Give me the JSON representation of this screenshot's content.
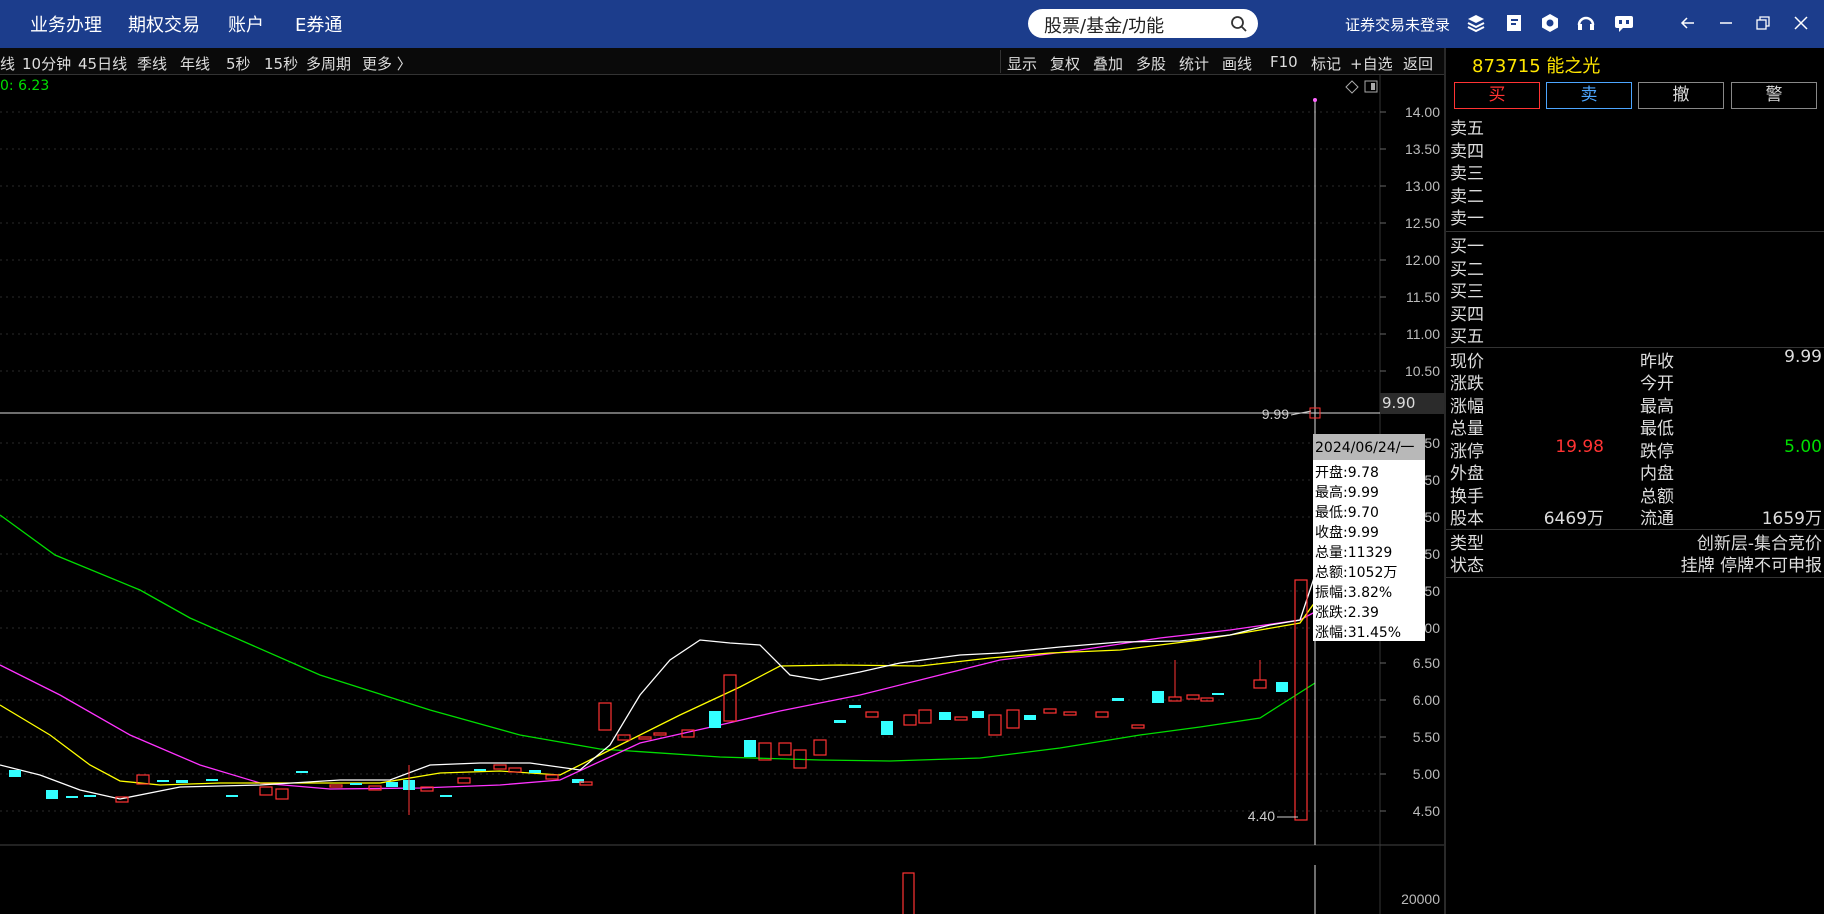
{
  "topbar": {
    "menu": [
      "业务办理",
      "期权交易",
      "账户",
      "E券通"
    ],
    "search_placeholder": "股票/基金/功能",
    "login_status": "证券交易未登录"
  },
  "toolbar": {
    "periods": [
      "线",
      "10分钟",
      "45日线",
      "季线",
      "年线",
      "5秒",
      "15秒",
      "多周期",
      "更多 〉"
    ],
    "tools": [
      "显示",
      "复权",
      "叠加",
      "多股",
      "统计",
      "画线",
      "F10",
      "标记",
      "+自选",
      "返回"
    ]
  },
  "chart": {
    "ma_readout": "0: 6.23",
    "y_ticks": [
      "14.00",
      "13.50",
      "13.00",
      "12.50",
      "12.00",
      "11.50",
      "11.00",
      "10.50",
      "6.50",
      "6.00",
      "5.50",
      "5.00",
      "4.50"
    ],
    "hidden_ticks": [
      "50",
      "50",
      "50",
      "50",
      "50",
      "00"
    ],
    "crosshair_price": "9.90",
    "high_marker": "9.99",
    "low_marker": "4.40",
    "volume_tick": "20000",
    "colors": {
      "up": "#ff3333",
      "down": "#33ffff",
      "ma1": "#ffffff",
      "ma2": "#ffff00",
      "ma3": "#ff33ff",
      "ma4": "#00dd00"
    }
  },
  "tooltip": {
    "date": "2024/06/24/一",
    "open": "开盘:9.78",
    "high": "最高:9.99",
    "low": "最低:9.70",
    "close": "收盘:9.99",
    "volume": "总量:11329",
    "amount": "总额:1052万",
    "amplitude": "振幅:3.82%",
    "change": "涨跌:2.39",
    "change_pct": "涨幅:31.45%"
  },
  "panel": {
    "title": "873715 能之光",
    "buttons": {
      "buy": "买",
      "sell": "卖",
      "cancel": "撤",
      "alert": "警"
    },
    "asks": [
      "卖五",
      "卖四",
      "卖三",
      "卖二",
      "卖一"
    ],
    "bids": [
      "买一",
      "买二",
      "买三",
      "买四",
      "买五"
    ],
    "quote": {
      "price_label": "现价",
      "prev_close_label": "昨收",
      "prev_close": "9.99",
      "change_label": "涨跌",
      "open_label": "今开",
      "change_pct_label": "涨幅",
      "high_label": "最高",
      "volume_label": "总量",
      "low_label": "最低",
      "limit_up_label": "涨停",
      "limit_up": "19.98",
      "limit_down_label": "跌停",
      "limit_down": "5.00",
      "outer_label": "外盘",
      "inner_label": "内盘",
      "turnover_label": "换手",
      "amount_label": "总额",
      "shares_label": "股本",
      "shares": "6469万",
      "float_label": "流通",
      "float": "1659万",
      "type_label": "类型",
      "type": "创新层-集合竞价",
      "status_label": "状态",
      "status": "挂牌 停牌不可申报"
    }
  }
}
